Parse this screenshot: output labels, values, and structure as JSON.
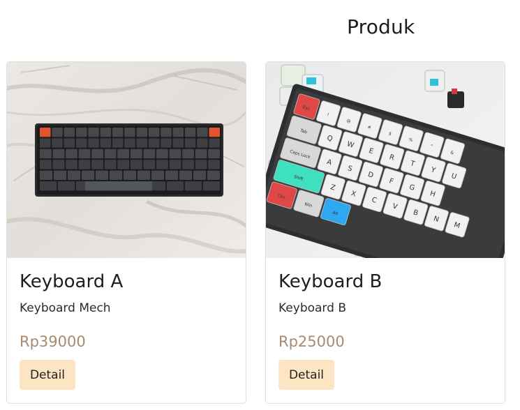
{
  "page": {
    "title": "Produk"
  },
  "products": [
    {
      "name": "Keyboard A",
      "description": "Keyboard Mech",
      "price": "Rp39000",
      "button_label": "Detail",
      "image_icon": "keyboard-dark-on-marble"
    },
    {
      "name": "Keyboard B",
      "description": "Keyboard B",
      "price": "Rp25000",
      "button_label": "Detail",
      "image_icon": "keyboard-white-with-switches"
    }
  ],
  "keycaps": {
    "row0": [
      "Esc",
      "!\n1",
      "@\n2",
      "#\n3",
      "$\n4",
      "%\n5",
      "^\n6",
      "&\n7"
    ],
    "row1": [
      "Tab",
      "Q",
      "W",
      "E",
      "R",
      "T",
      "Y",
      "U"
    ],
    "row2": [
      "Caps Lock",
      "A",
      "S",
      "D",
      "F",
      "G",
      "H"
    ],
    "row3": [
      "Shift",
      "Z",
      "X",
      "C",
      "V",
      "B",
      "N",
      "M"
    ],
    "row4": [
      "Ctrl",
      "Win",
      "Alt"
    ]
  },
  "colors": {
    "price": "#a88a6e",
    "button_bg": "#fde5c3",
    "border": "#dfdfdf"
  }
}
